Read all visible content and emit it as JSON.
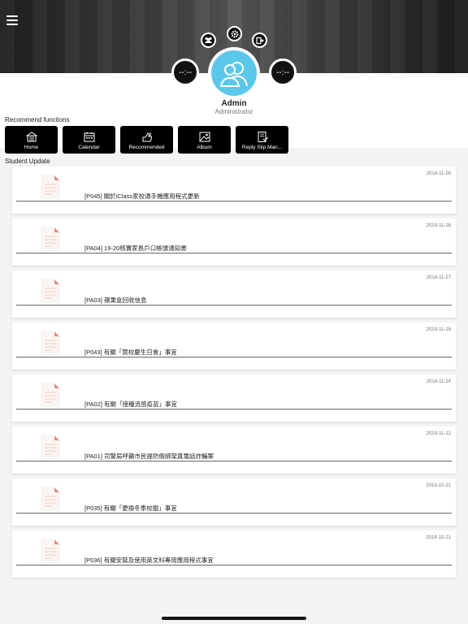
{
  "header": {
    "menu_icon": "hamburger-icon"
  },
  "top_icons": {
    "group": "group-icon",
    "settings": "gear-icon",
    "logout": "logout-icon"
  },
  "counters": {
    "left": "--:--",
    "right": "--:--"
  },
  "user": {
    "name": "Admin",
    "role": "Administrator",
    "avatar_color": "#5bc8ea"
  },
  "recommend": {
    "label": "Recommend functions",
    "items": [
      {
        "label": "Home",
        "icon": "school-icon"
      },
      {
        "label": "Calendar",
        "icon": "calendar-icon"
      },
      {
        "label": "Recommended",
        "icon": "recommended-icon"
      },
      {
        "label": "Album",
        "icon": "album-icon"
      },
      {
        "label": "Reply Slip Man...",
        "icon": "reply-slip-icon"
      }
    ]
  },
  "updates": {
    "label": "Student Update",
    "items": [
      {
        "date": "2019-11-28",
        "title": "[P045] 關於iClass家校通手機應用程式更新"
      },
      {
        "date": "2019-11-28",
        "title": "[PA04] 19-20核實家長戶口帳號通知書"
      },
      {
        "date": "2019-11-27",
        "title": "[PA03] 蘋果盒回收信息"
      },
      {
        "date": "2019-11-18",
        "title": "[P043] 有關「賀校慶生日會」事宜"
      },
      {
        "date": "2019-11-14",
        "title": "[PA02] 有關「接種流感疫苗」事宜"
      },
      {
        "date": "2019-11-12",
        "title": "[PA01] 司警局呼籲市民提防假綁架真電話詐騙案"
      },
      {
        "date": "2019-10-21",
        "title": "[P035] 有關「更換冬季校服」事宜"
      },
      {
        "date": "2019-10-21",
        "title": "[P036] 有關安裝及使用英文科專用應用程式事宜"
      }
    ]
  }
}
